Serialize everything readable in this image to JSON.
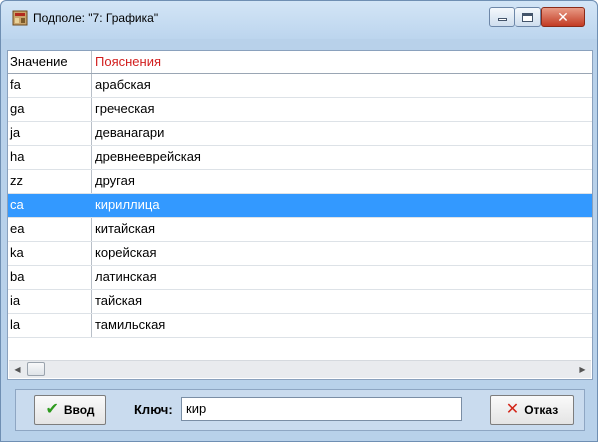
{
  "window": {
    "title": "Подполе: \"7: Графика\""
  },
  "grid": {
    "columns": [
      "Значение",
      "Пояснения"
    ],
    "rows": [
      {
        "value": "fa",
        "explanation": "арабская"
      },
      {
        "value": "ga",
        "explanation": "греческая"
      },
      {
        "value": "ja",
        "explanation": "деванагари"
      },
      {
        "value": "ha",
        "explanation": "древнееврейская"
      },
      {
        "value": "zz",
        "explanation": "другая"
      },
      {
        "value": "ca",
        "explanation": "кириллица"
      },
      {
        "value": "ea",
        "explanation": "китайская"
      },
      {
        "value": "ka",
        "explanation": "корейская"
      },
      {
        "value": "ba",
        "explanation": "латинская"
      },
      {
        "value": "ia",
        "explanation": "тайская"
      },
      {
        "value": "la",
        "explanation": "тамильская"
      }
    ],
    "selected_index": 5
  },
  "bottom": {
    "ok_label": "Ввод",
    "key_label": "Ключ:",
    "key_value": "кир",
    "cancel_label": "Отказ"
  },
  "icons": {
    "app": "app-icon",
    "minimize": "minimize-icon",
    "maximize": "maximize-icon",
    "close": "close-icon",
    "ok": "checkmark-icon",
    "cancel": "x-icon",
    "scroll_left": "arrow-left-icon",
    "scroll_right": "arrow-right-icon"
  },
  "colors": {
    "selection": "#3399ff",
    "header_explanation": "#d21e1e",
    "window_frame": "#b8d1ea"
  }
}
